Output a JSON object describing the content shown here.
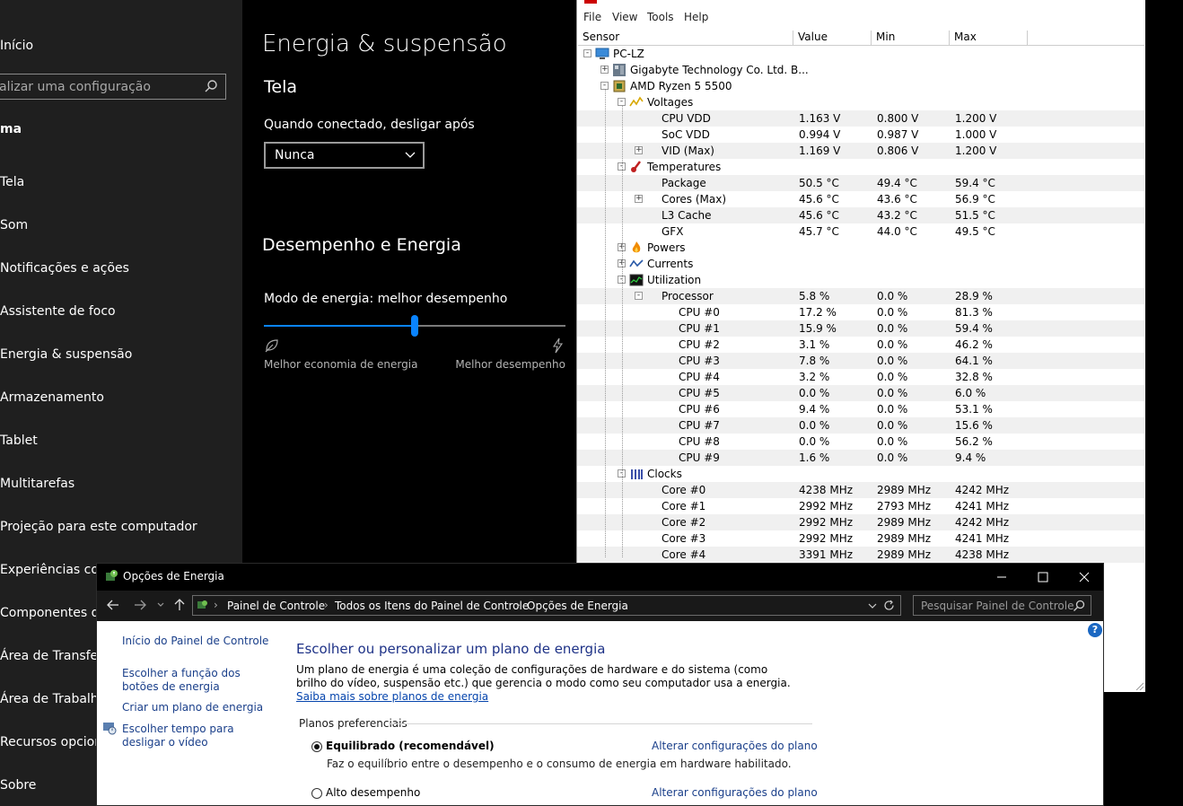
{
  "settings": {
    "sidebar": {
      "home": "Início",
      "search_placeholder": "alizar uma configuração",
      "category": "ma",
      "items": [
        {
          "label": "Tela"
        },
        {
          "label": "Som"
        },
        {
          "label": "Notificações e ações"
        },
        {
          "label": "Assistente de foco"
        },
        {
          "label": "Energia & suspensão"
        },
        {
          "label": "Armazenamento"
        },
        {
          "label": "Tablet"
        },
        {
          "label": "Multitarefas"
        },
        {
          "label": "Projeção para este computador"
        },
        {
          "label": "Experiências comp"
        },
        {
          "label": "Componentes do"
        },
        {
          "label": "Área de Transferê"
        },
        {
          "label": "Área de Trabalho"
        },
        {
          "label": "Recursos opcional"
        },
        {
          "label": "Sobre"
        }
      ]
    },
    "main": {
      "title": "Energia & suspensão",
      "screen_section": "Tela",
      "plugged_label": "Quando conectado, desligar após",
      "plugged_value": "Nunca",
      "perf_section": "Desempenho e Energia",
      "mode_label": "Modo de energia: melhor desempenho",
      "slider_level": 0.5,
      "slider_min_label": "Melhor economia de energia",
      "slider_max_label": "Melhor desempenho",
      "accent_color": "#0a84ff"
    }
  },
  "hwmonitor": {
    "menu": [
      "File",
      "View",
      "Tools",
      "Help"
    ],
    "columns": [
      "Sensor",
      "Value",
      "Min",
      "Max"
    ],
    "rows": [
      {
        "depth": 0,
        "expander": "-",
        "icon": "computer-icon",
        "name": "PC-LZ",
        "v": "",
        "mn": "",
        "mx": "",
        "shade": false
      },
      {
        "depth": 1,
        "expander": "+",
        "icon": "motherboard-icon",
        "name": "Gigabyte Technology Co. Ltd. B...",
        "v": "",
        "mn": "",
        "mx": "",
        "shade": false
      },
      {
        "depth": 1,
        "expander": "-",
        "icon": "cpu-chip-icon",
        "name": "AMD Ryzen 5 5500",
        "v": "",
        "mn": "",
        "mx": "",
        "shade": false
      },
      {
        "depth": 2,
        "expander": "-",
        "icon": "voltage-icon",
        "name": "Voltages",
        "v": "",
        "mn": "",
        "mx": "",
        "shade": false
      },
      {
        "depth": 3,
        "expander": "",
        "icon": "",
        "name": "CPU VDD",
        "v": "1.163 V",
        "mn": "0.800 V",
        "mx": "1.200 V",
        "shade": true
      },
      {
        "depth": 3,
        "expander": "",
        "icon": "",
        "name": "SoC VDD",
        "v": "0.994 V",
        "mn": "0.987 V",
        "mx": "1.000 V",
        "shade": false
      },
      {
        "depth": 3,
        "expander": "+",
        "icon": "",
        "name": "VID (Max)",
        "v": "1.169 V",
        "mn": "0.806 V",
        "mx": "1.200 V",
        "shade": true
      },
      {
        "depth": 2,
        "expander": "-",
        "icon": "thermometer-icon",
        "name": "Temperatures",
        "v": "",
        "mn": "",
        "mx": "",
        "shade": false
      },
      {
        "depth": 3,
        "expander": "",
        "icon": "",
        "name": "Package",
        "v": "50.5 °C",
        "mn": "49.4 °C",
        "mx": "59.4 °C",
        "shade": true
      },
      {
        "depth": 3,
        "expander": "+",
        "icon": "",
        "name": "Cores (Max)",
        "v": "45.6 °C",
        "mn": "43.6 °C",
        "mx": "56.9 °C",
        "shade": false
      },
      {
        "depth": 3,
        "expander": "",
        "icon": "",
        "name": "L3 Cache",
        "v": "45.6 °C",
        "mn": "43.2 °C",
        "mx": "51.5 °C",
        "shade": true
      },
      {
        "depth": 3,
        "expander": "",
        "icon": "",
        "name": "GFX",
        "v": "45.7 °C",
        "mn": "44.0 °C",
        "mx": "49.5 °C",
        "shade": false
      },
      {
        "depth": 2,
        "expander": "+",
        "icon": "flame-icon",
        "name": "Powers",
        "v": "",
        "mn": "",
        "mx": "",
        "shade": false
      },
      {
        "depth": 2,
        "expander": "+",
        "icon": "current-wave-icon",
        "name": "Currents",
        "v": "",
        "mn": "",
        "mx": "",
        "shade": false
      },
      {
        "depth": 2,
        "expander": "-",
        "icon": "utilization-monitor-icon",
        "name": "Utilization",
        "v": "",
        "mn": "",
        "mx": "",
        "shade": false
      },
      {
        "depth": 3,
        "expander": "-",
        "icon": "",
        "name": "Processor",
        "v": "5.8 %",
        "mn": "0.0 %",
        "mx": "28.9 %",
        "shade": true
      },
      {
        "depth": 4,
        "expander": "",
        "icon": "",
        "name": "CPU #0",
        "v": "17.2 %",
        "mn": "0.0 %",
        "mx": "81.3 %",
        "shade": false
      },
      {
        "depth": 4,
        "expander": "",
        "icon": "",
        "name": "CPU #1",
        "v": "15.9 %",
        "mn": "0.0 %",
        "mx": "59.4 %",
        "shade": true
      },
      {
        "depth": 4,
        "expander": "",
        "icon": "",
        "name": "CPU #2",
        "v": "3.1 %",
        "mn": "0.0 %",
        "mx": "46.2 %",
        "shade": false
      },
      {
        "depth": 4,
        "expander": "",
        "icon": "",
        "name": "CPU #3",
        "v": "7.8 %",
        "mn": "0.0 %",
        "mx": "64.1 %",
        "shade": true
      },
      {
        "depth": 4,
        "expander": "",
        "icon": "",
        "name": "CPU #4",
        "v": "3.2 %",
        "mn": "0.0 %",
        "mx": "32.8 %",
        "shade": false
      },
      {
        "depth": 4,
        "expander": "",
        "icon": "",
        "name": "CPU #5",
        "v": "0.0 %",
        "mn": "0.0 %",
        "mx": "6.0 %",
        "shade": true
      },
      {
        "depth": 4,
        "expander": "",
        "icon": "",
        "name": "CPU #6",
        "v": "9.4 %",
        "mn": "0.0 %",
        "mx": "53.1 %",
        "shade": false
      },
      {
        "depth": 4,
        "expander": "",
        "icon": "",
        "name": "CPU #7",
        "v": "0.0 %",
        "mn": "0.0 %",
        "mx": "15.6 %",
        "shade": true
      },
      {
        "depth": 4,
        "expander": "",
        "icon": "",
        "name": "CPU #8",
        "v": "0.0 %",
        "mn": "0.0 %",
        "mx": "56.2 %",
        "shade": false
      },
      {
        "depth": 4,
        "expander": "",
        "icon": "",
        "name": "CPU #9",
        "v": "1.6 %",
        "mn": "0.0 %",
        "mx": "9.4 %",
        "shade": true
      },
      {
        "depth": 2,
        "expander": "-",
        "icon": "clock-bars-icon",
        "name": "Clocks",
        "v": "",
        "mn": "",
        "mx": "",
        "shade": false
      },
      {
        "depth": 3,
        "expander": "",
        "icon": "",
        "name": "Core #0",
        "v": "4238 MHz",
        "mn": "2989 MHz",
        "mx": "4242 MHz",
        "shade": true
      },
      {
        "depth": 3,
        "expander": "",
        "icon": "",
        "name": "Core #1",
        "v": "2992 MHz",
        "mn": "2793 MHz",
        "mx": "4241 MHz",
        "shade": false
      },
      {
        "depth": 3,
        "expander": "",
        "icon": "",
        "name": "Core #2",
        "v": "2992 MHz",
        "mn": "2989 MHz",
        "mx": "4242 MHz",
        "shade": true
      },
      {
        "depth": 3,
        "expander": "",
        "icon": "",
        "name": "Core #3",
        "v": "2992 MHz",
        "mn": "2989 MHz",
        "mx": "4241 MHz",
        "shade": false
      },
      {
        "depth": 3,
        "expander": "",
        "icon": "",
        "name": "Core #4",
        "v": "3391 MHz",
        "mn": "2989 MHz",
        "mx": "4238 MHz",
        "shade": true
      }
    ]
  },
  "control_panel": {
    "title": "Opções de Energia",
    "breadcrumbs": [
      "Painel de Controle",
      "Todos os Itens do Painel de Controle",
      "Opções de Energia"
    ],
    "search_placeholder": "Pesquisar Painel de Controle",
    "left_links": {
      "home": "Início do Painel de Controle",
      "buttons": "Escolher a função dos botões de energia",
      "create_plan": "Criar um plano de energia",
      "display_off": "Escolher tempo para desligar o vídeo"
    },
    "heading": "Escolher ou personalizar um plano de energia",
    "description": "Um plano de energia é uma coleção de configurações de hardware e do sistema (como brilho do vídeo, suspensão etc.) que gerencia o modo como seu computador usa a energia.",
    "learn_more": "Saiba mais sobre planos de energia",
    "group_label": "Planos preferenciais",
    "plans": [
      {
        "name": "Equilibrado (recomendável)",
        "selected": true,
        "link": "Alterar configurações do plano",
        "desc": "Faz o equilíbrio entre o desempenho e o consumo de energia em hardware habilitado."
      },
      {
        "name": "Alto desempenho",
        "selected": false,
        "link": "Alterar configurações do plano",
        "desc": ""
      }
    ],
    "help": "?"
  }
}
